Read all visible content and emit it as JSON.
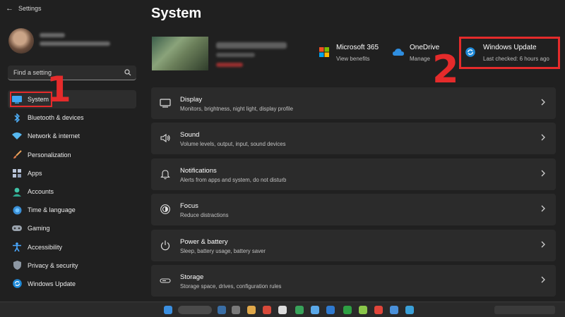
{
  "window": {
    "title": "Settings"
  },
  "search": {
    "placeholder": "Find a setting"
  },
  "sidebar": {
    "items": [
      {
        "label": "System",
        "icon": "display-icon",
        "active": true
      },
      {
        "label": "Bluetooth & devices",
        "icon": "bluetooth-icon"
      },
      {
        "label": "Network & internet",
        "icon": "wifi-icon"
      },
      {
        "label": "Personalization",
        "icon": "brush-icon"
      },
      {
        "label": "Apps",
        "icon": "apps-icon"
      },
      {
        "label": "Accounts",
        "icon": "person-icon"
      },
      {
        "label": "Time & language",
        "icon": "globe-icon"
      },
      {
        "label": "Gaming",
        "icon": "gamepad-icon"
      },
      {
        "label": "Accessibility",
        "icon": "accessibility-icon"
      },
      {
        "label": "Privacy & security",
        "icon": "shield-icon"
      },
      {
        "label": "Windows Update",
        "icon": "update-icon"
      }
    ]
  },
  "main": {
    "title": "System",
    "quick_links": [
      {
        "title": "Microsoft 365",
        "subtitle": "View benefits",
        "icon": "microsoft-logo-icon"
      },
      {
        "title": "OneDrive",
        "subtitle": "Manage",
        "icon": "cloud-icon"
      },
      {
        "title": "Windows Update",
        "subtitle": "Last checked: 6 hours ago",
        "icon": "sync-icon"
      }
    ],
    "cards": [
      {
        "title": "Display",
        "subtitle": "Monitors, brightness, night light, display profile",
        "icon": "monitor-icon"
      },
      {
        "title": "Sound",
        "subtitle": "Volume levels, output, input, sound devices",
        "icon": "speaker-icon"
      },
      {
        "title": "Notifications",
        "subtitle": "Alerts from apps and system, do not disturb",
        "icon": "bell-icon"
      },
      {
        "title": "Focus",
        "subtitle": "Reduce distractions",
        "icon": "focus-icon"
      },
      {
        "title": "Power & battery",
        "subtitle": "Sleep, battery usage, battery saver",
        "icon": "power-icon"
      },
      {
        "title": "Storage",
        "subtitle": "Storage space, drives, configuration rules",
        "icon": "storage-icon"
      }
    ]
  },
  "annotations": {
    "step1": "1",
    "step2": "2"
  },
  "colors": {
    "accent": "#4cc2ff",
    "annotation": "#e52b2b",
    "background": "#202020",
    "card": "#2b2b2b"
  }
}
